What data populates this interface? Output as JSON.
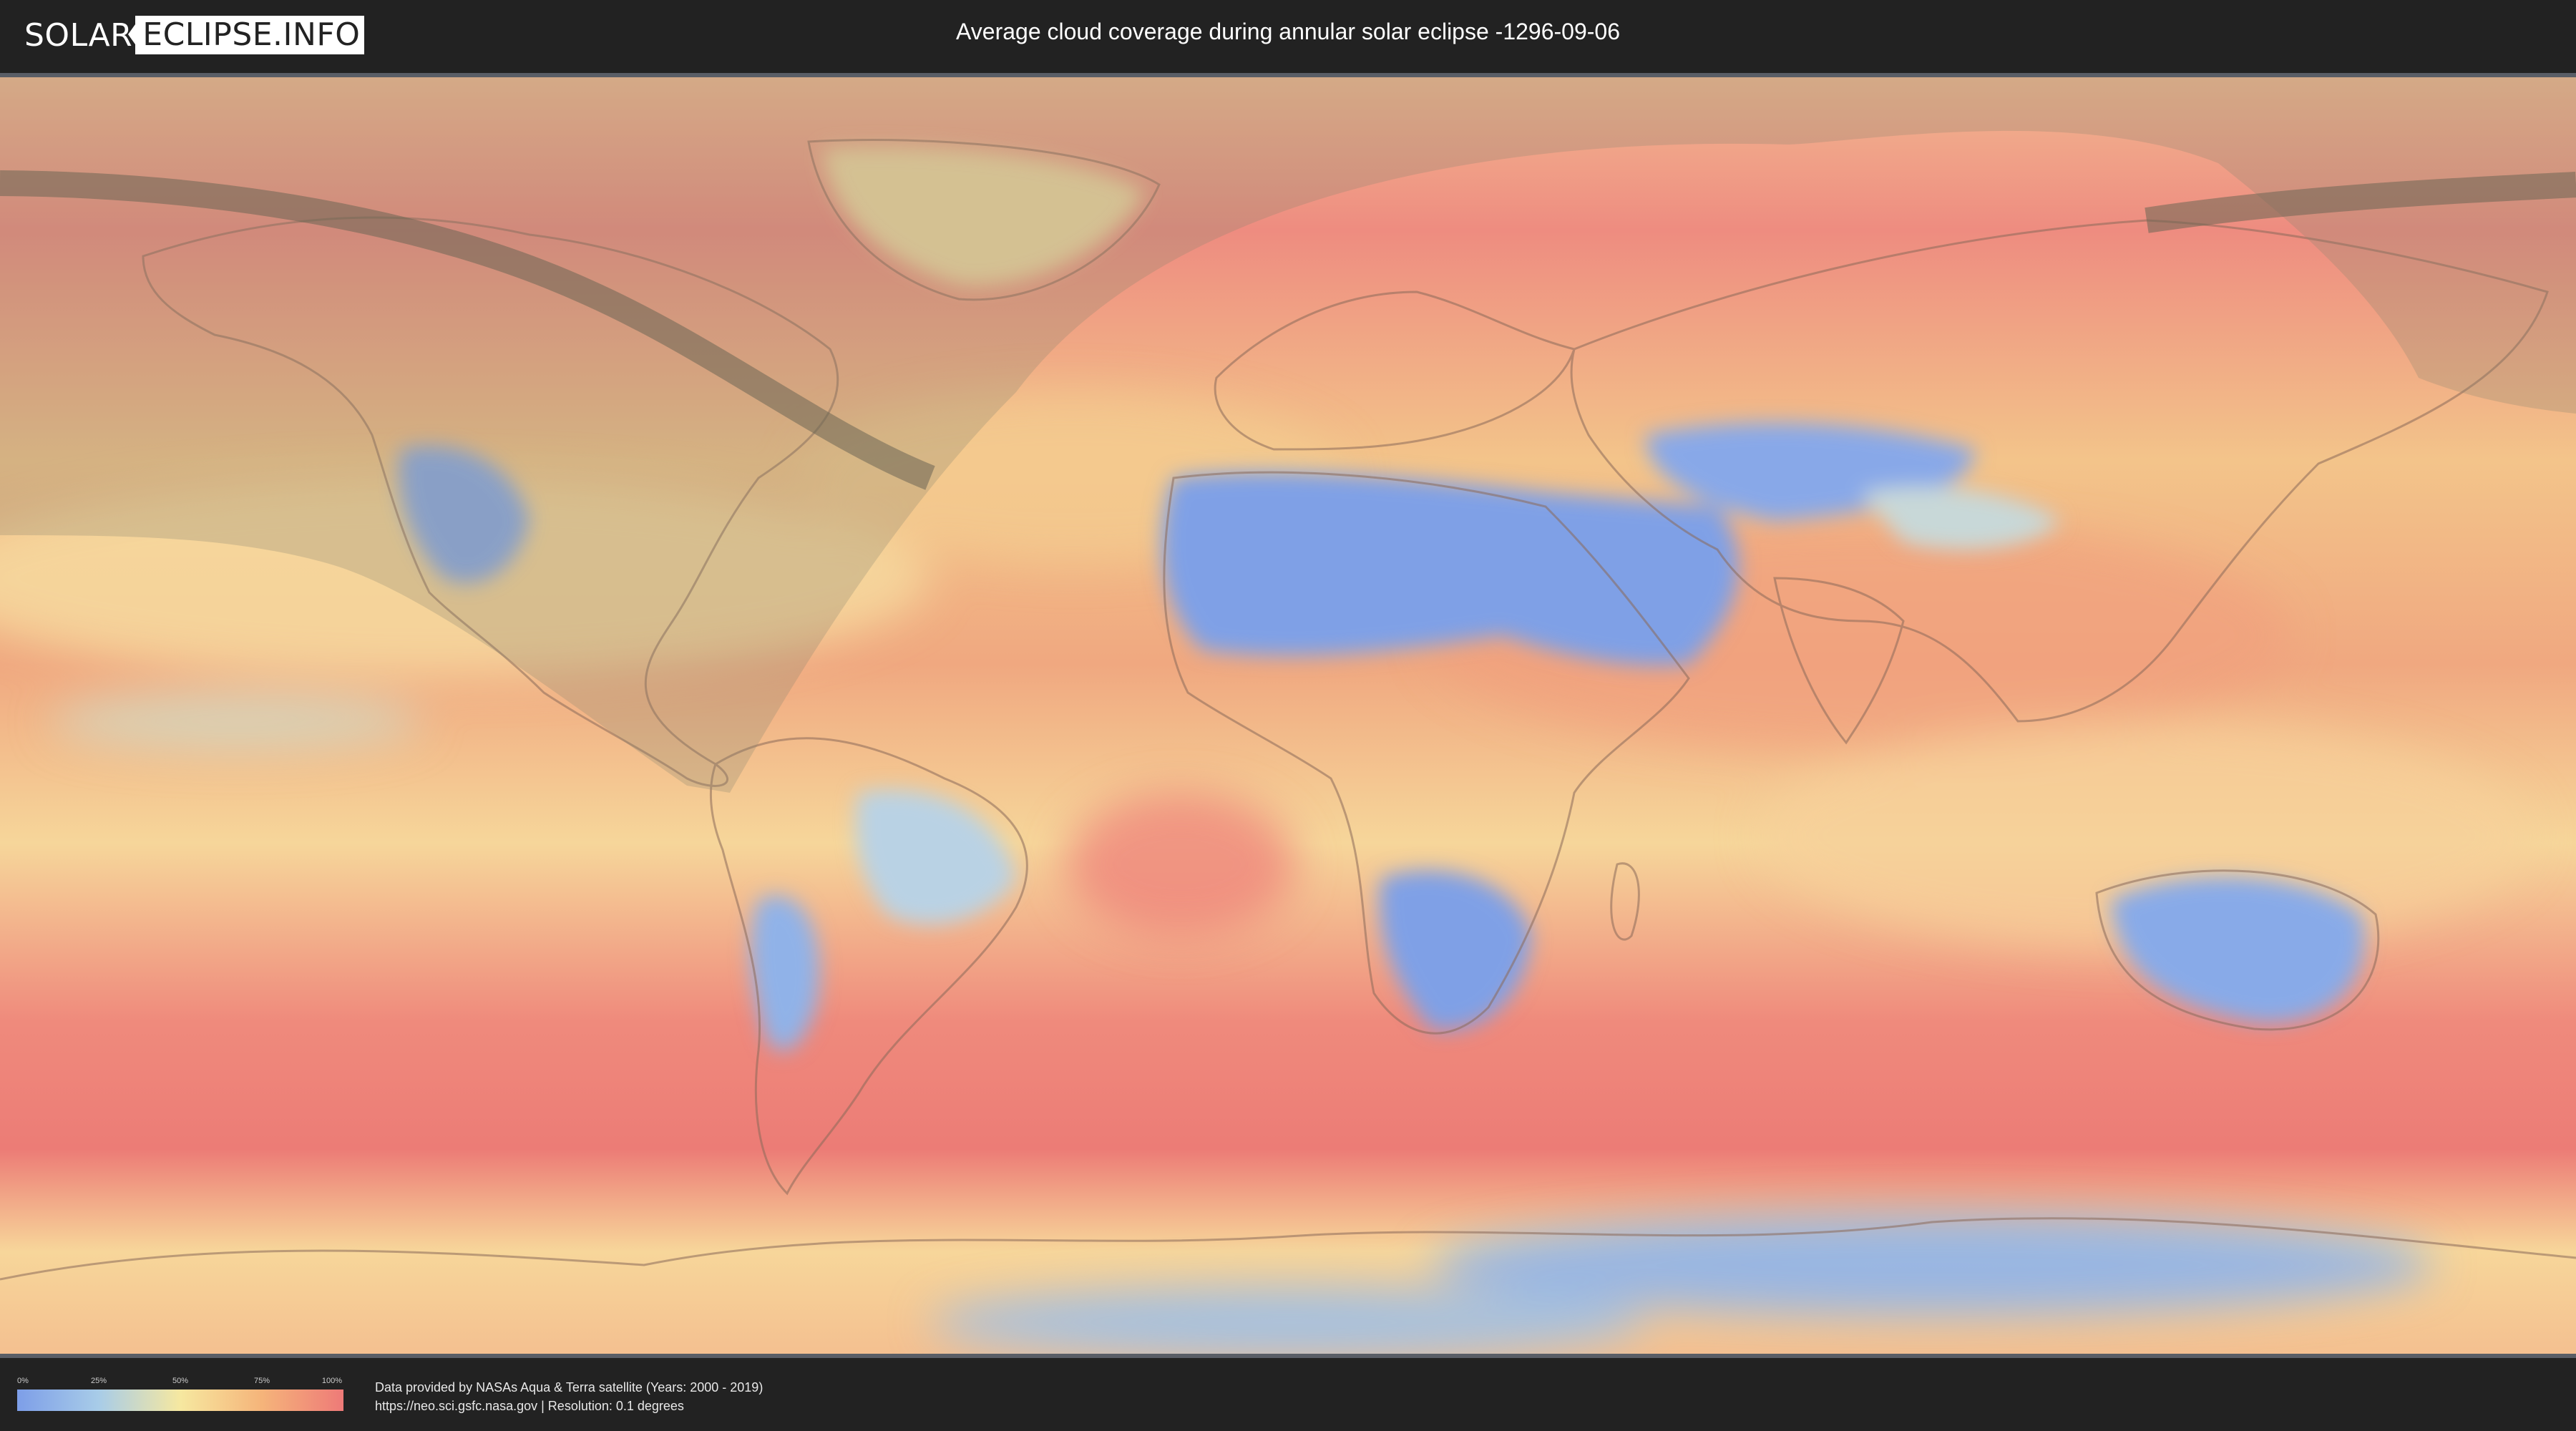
{
  "header": {
    "logo_left": "SOLAR",
    "logo_right": "ECLIPSE.INFO",
    "title": "Average cloud coverage during annular solar eclipse -1296-09-06"
  },
  "legend": {
    "ticks": [
      "0%",
      "25%",
      "50%",
      "75%",
      "100%"
    ],
    "colors": [
      "#7d9ee8",
      "#a8cce8",
      "#f6e8a0",
      "#f5b47a",
      "#ee7a78"
    ]
  },
  "footer": {
    "credit_line1": "Data provided by NASAs Aqua & Terra satellite (Years: 2000 - 2019)",
    "credit_line2": "https://neo.sci.gsfc.nasa.gov | Resolution: 0.1 degrees"
  },
  "map": {
    "base_color": "#f0a878",
    "clear_color": "#7d9ee8",
    "cloudy_color": "#ee7a78",
    "eclipse_path_color": "#6b6654",
    "visibility_shade_color": "#8a8470"
  }
}
